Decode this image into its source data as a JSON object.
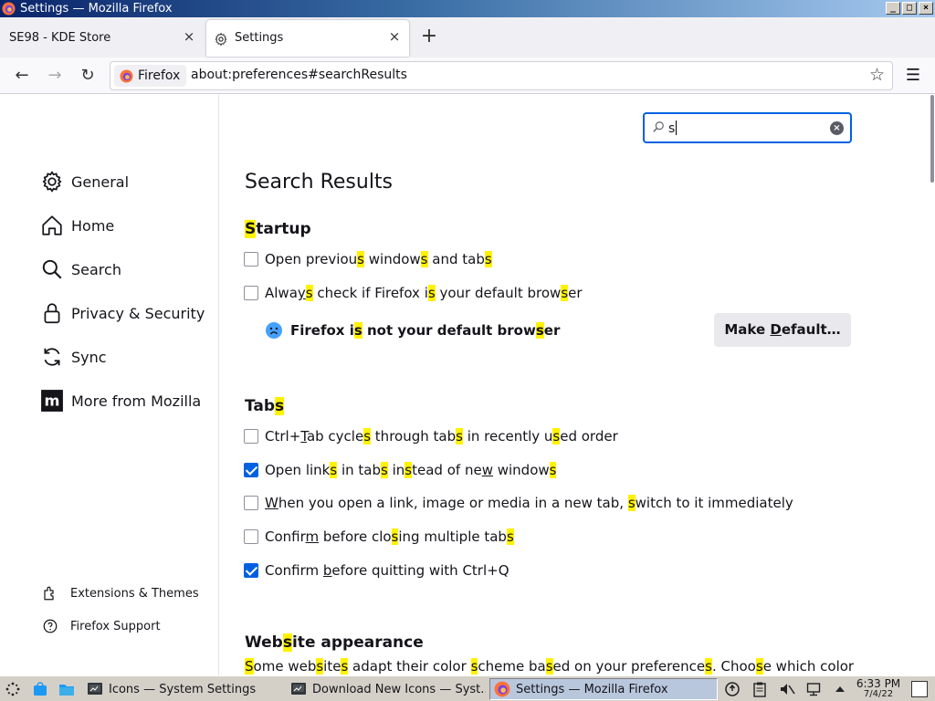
{
  "window": {
    "title": "Settings — Mozilla Firefox"
  },
  "tabs": [
    {
      "label": "SE98 - KDE Store",
      "close": "×"
    },
    {
      "label": "Settings",
      "close": "×"
    }
  ],
  "newtab": "+",
  "nav": {
    "back": "←",
    "forward": "→",
    "reload": "↻",
    "menu": "☰",
    "bookmark": "☆",
    "identity_label": "Firefox",
    "url": "about:preferences#searchResults"
  },
  "sidebar": {
    "categories": [
      {
        "label": "General",
        "icon": "gear-icon"
      },
      {
        "label": "Home",
        "icon": "home-icon"
      },
      {
        "label": "Search",
        "icon": "search-icon"
      },
      {
        "label": "Privacy & Security",
        "icon": "lock-icon"
      },
      {
        "label": "Sync",
        "icon": "sync-icon"
      },
      {
        "label": "More from Mozilla",
        "icon": "mozilla-icon"
      }
    ],
    "footer": [
      {
        "label": "Extensions & Themes",
        "icon": "puzzle-icon"
      },
      {
        "label": "Firefox Support",
        "icon": "help-icon"
      }
    ]
  },
  "search": {
    "value": "s"
  },
  "results": {
    "heading": "Search Results",
    "startup": {
      "heading": "Startup",
      "open_previous": {
        "label": "Open previous windows and tabs",
        "checked": false
      },
      "always_check": {
        "label": "Always check if Firefox is your default browser",
        "checked": false
      },
      "not_default": "Firefox is not your default browser",
      "make_default_button": "Make Default…"
    },
    "tabs_section": {
      "heading": "Tabs",
      "items": [
        {
          "label": "Ctrl+Tab cycles through tabs in recently used order",
          "checked": false
        },
        {
          "label": "Open links in tabs instead of new windows",
          "checked": true
        },
        {
          "label": "When you open a link, image or media in a new tab, switch to it immediately",
          "checked": false
        },
        {
          "label": "Confirm before closing multiple tabs",
          "checked": false
        },
        {
          "label": "Confirm before quitting with Ctrl+Q",
          "checked": true
        }
      ]
    },
    "website_appearance": {
      "heading": "Website appearance",
      "description": "Some websites adapt their color scheme based on your preferences. Choose which color"
    }
  },
  "taskbar": {
    "tasks": [
      {
        "label": "Icons — System Settings",
        "active": false
      },
      {
        "label": "Download New Icons — Syst...",
        "active": false
      },
      {
        "label": "Settings — Mozilla Firefox",
        "active": true
      }
    ],
    "clock": {
      "time": "6:33 PM",
      "date": "7/4/22"
    }
  },
  "colors": {
    "accent": "#0061e0",
    "highlight": "#fff200",
    "taskbar": "#d4d0c8"
  }
}
